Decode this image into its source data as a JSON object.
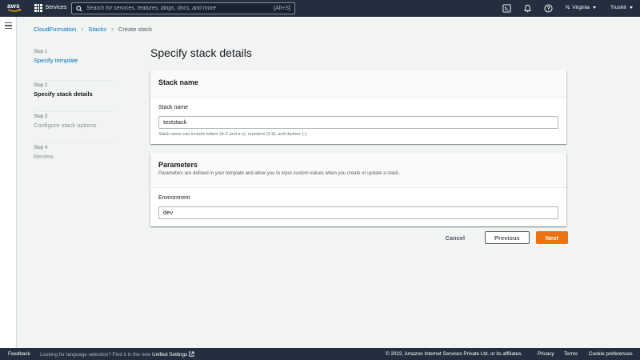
{
  "topnav": {
    "logo_text": "aws",
    "services_label": "Services",
    "search_placeholder": "Search for services, features, blogs, docs, and more",
    "search_shortcut": "[Alt+S]",
    "region": "N. Virginia",
    "account": "Trushit",
    "icons": [
      "cloudshell-icon",
      "bell-icon",
      "help-icon"
    ]
  },
  "breadcrumb": {
    "items": [
      "CloudFormation",
      "Stacks",
      "Create stack"
    ]
  },
  "steps": [
    {
      "number": "Step 1",
      "label": "Specify template",
      "state": "link"
    },
    {
      "number": "Step 2",
      "label": "Specify stack details",
      "state": "active"
    },
    {
      "number": "Step 3",
      "label": "Configure stack options",
      "state": "disabled"
    },
    {
      "number": "Step 4",
      "label": "Review",
      "state": "disabled"
    }
  ],
  "page_title": "Specify stack details",
  "stack_name_panel": {
    "title": "Stack name",
    "field_label": "Stack name",
    "value": "teststack",
    "constraint": "Stack name can include letters (A-Z and a-z), numbers (0-9), and dashes (-)."
  },
  "parameters_panel": {
    "title": "Parameters",
    "description": "Parameters are defined in your template and allow you to input custom values when you create or update a stack.",
    "field_label": "Environment",
    "value": "dev"
  },
  "actions": {
    "cancel": "Cancel",
    "previous": "Previous",
    "next": "Next"
  },
  "footer": {
    "feedback": "Feedback",
    "lang_text": "Looking for language selection? Find it in the new",
    "lang_link": "Unified Settings",
    "copyright": "© 2022, Amazon Internet Services Private Ltd. or its affiliates.",
    "privacy": "Privacy",
    "terms": "Terms",
    "cookies": "Cookie preferences"
  },
  "colors": {
    "nav_bg": "#232f3e",
    "link": "#0073bb",
    "primary": "#ec7211",
    "page_bg": "#f2f3f3"
  }
}
